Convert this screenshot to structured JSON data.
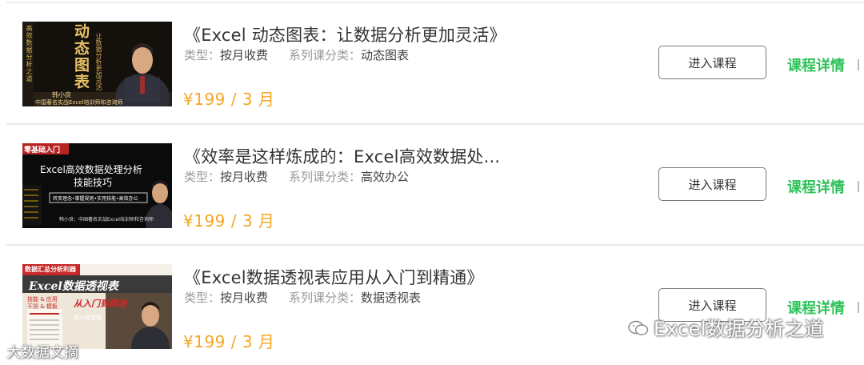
{
  "courses": [
    {
      "title": "《Excel 动态图表：让数据分析更加灵活》",
      "type_label": "类型：",
      "type_value": "按月收费",
      "category_label": "系列课分类：",
      "category_value": "动态图表",
      "price": "¥199 / 3 月",
      "enter_label": "进入课程",
      "detail_label": "课程详情",
      "thumb": {
        "headline": "动态图表",
        "side_text": "高效数据分析之道",
        "sub_text": "让数据分析更加灵活",
        "author": "韩小良",
        "caption": "中国著名实战Excel培训师和咨询师"
      }
    },
    {
      "title": "《效率是这样炼成的：Excel高效数据处...",
      "type_label": "类型：",
      "type_value": "按月收费",
      "category_label": "系列课分类：",
      "category_value": "高效办公",
      "price": "¥199 / 3 月",
      "enter_label": "进入课程",
      "detail_label": "课程详情",
      "thumb": {
        "badge": "零基础入门",
        "headline_1": "Excel高效数据处理分析",
        "headline_2": "技能技巧",
        "bar_text": "转变理念•掌握规则•实用技能•高效办公",
        "caption": "韩小良：中国著名实战Excel培训师和咨询师"
      }
    },
    {
      "title": "《Excel数据透视表应用从入门到精通》",
      "type_label": "类型：",
      "type_value": "按月收费",
      "category_label": "系列课分类：",
      "category_value": "数据透视表",
      "price": "¥199 / 3 月",
      "enter_label": "进入课程",
      "detail_label": "课程详情",
      "thumb": {
        "badge": "数据汇总分析利器",
        "headline": "Excel数据透视表",
        "tag_1": "技能 & 应用",
        "tag_2": "干货 & 模板",
        "slogan": "从入门到精通",
        "author": "韩小良老师"
      }
    }
  ],
  "watermarks": {
    "right": "Excel数据分析之道",
    "left": "大数据文摘"
  },
  "colors": {
    "price": "#f5a623",
    "detail_link": "#2ec25a",
    "divider": "#ebebeb"
  }
}
